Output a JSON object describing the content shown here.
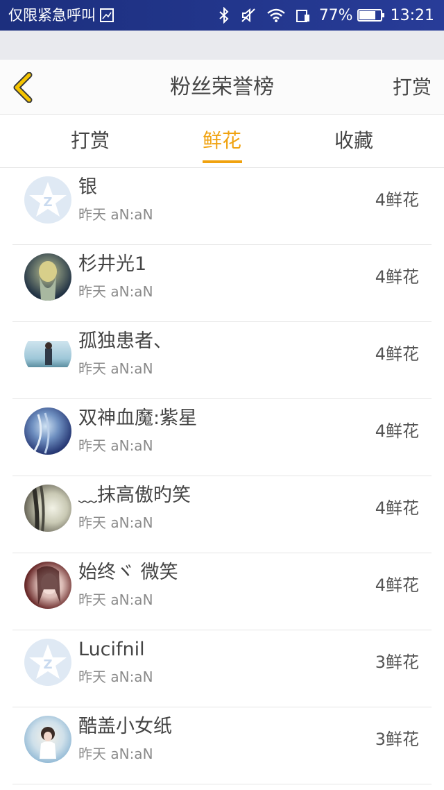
{
  "status_bar": {
    "carrier": "仅限紧急呼叫",
    "battery_percent_label": "77%",
    "battery_level": 0.77,
    "time": "13:21",
    "icons": [
      "image-icon",
      "bluetooth-icon",
      "mute-icon",
      "wifi-icon",
      "sim-icon",
      "battery-icon"
    ]
  },
  "header": {
    "title": "粉丝荣誉榜",
    "action_label": "打赏",
    "back_icon": "chevron-left-icon",
    "accent_color": "#f0a20f"
  },
  "tabs": [
    {
      "label": "打赏",
      "active": false
    },
    {
      "label": "鲜花",
      "active": true
    },
    {
      "label": "收藏",
      "active": false
    }
  ],
  "list": [
    {
      "name": "银",
      "time": "昨天 aN:aN",
      "count": "4鲜花",
      "avatar": "default-avatar"
    },
    {
      "name": "杉井光1",
      "time": "昨天 aN:aN",
      "count": "4鲜花",
      "avatar": "photo-avatar"
    },
    {
      "name": "孤独患者、",
      "time": "昨天 aN:aN",
      "count": "4鲜花",
      "avatar": "photo-avatar"
    },
    {
      "name": "双神血魔:紫星",
      "time": "昨天 aN:aN",
      "count": "4鲜花",
      "avatar": "photo-avatar"
    },
    {
      "name": "﹏抹高傲旳笑",
      "time": "昨天 aN:aN",
      "count": "4鲜花",
      "avatar": "photo-avatar"
    },
    {
      "name": "始终ヾ 微笑",
      "time": "昨天 aN:aN",
      "count": "4鲜花",
      "avatar": "photo-avatar"
    },
    {
      "name": "Lucifnil",
      "time": "昨天 aN:aN",
      "count": "3鲜花",
      "avatar": "default-avatar"
    },
    {
      "name": "酷盖小女纸",
      "time": "昨天 aN:aN",
      "count": "3鲜花",
      "avatar": "photo-avatar"
    }
  ]
}
